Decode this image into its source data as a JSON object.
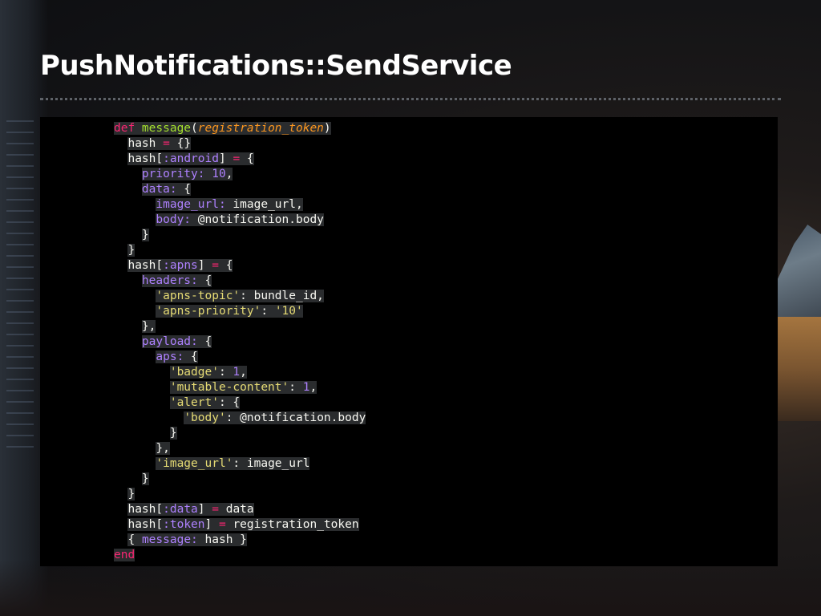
{
  "slide": {
    "title": "PushNotifications::SendService"
  },
  "code": {
    "lines": [
      [
        [
          "",
          "k",
          "def "
        ],
        [
          "",
          "f",
          "message"
        ],
        [
          "",
          "t",
          "("
        ],
        [
          "",
          "p",
          "registration_token"
        ],
        [
          "",
          "t",
          ")"
        ]
      ],
      [
        [
          "  ",
          "t",
          "hash "
        ],
        [
          "",
          "k",
          "="
        ],
        [
          "",
          "t",
          " {}"
        ]
      ],
      [
        [
          "  ",
          "t",
          "hash["
        ],
        [
          "",
          "s",
          ":android"
        ],
        [
          "",
          "t",
          "] "
        ],
        [
          "",
          "k",
          "="
        ],
        [
          "",
          "t",
          " {"
        ]
      ],
      [
        [
          "    ",
          "s",
          "priority:"
        ],
        [
          "",
          "t",
          " "
        ],
        [
          "",
          "s",
          "10"
        ],
        [
          "",
          "t",
          ","
        ]
      ],
      [
        [
          "    ",
          "s",
          "data:"
        ],
        [
          "",
          "t",
          " {"
        ]
      ],
      [
        [
          "      ",
          "s",
          "image_url:"
        ],
        [
          "",
          "t",
          " image_url,"
        ]
      ],
      [
        [
          "      ",
          "s",
          "body:"
        ],
        [
          "",
          "t",
          " @notification.body"
        ]
      ],
      [
        [
          "    ",
          "t",
          "}"
        ]
      ],
      [
        [
          "  ",
          "t",
          "}"
        ]
      ],
      [
        [
          "  ",
          "t",
          "hash["
        ],
        [
          "",
          "s",
          ":apns"
        ],
        [
          "",
          "t",
          "] "
        ],
        [
          "",
          "k",
          "="
        ],
        [
          "",
          "t",
          " {"
        ]
      ],
      [
        [
          "    ",
          "s",
          "headers:"
        ],
        [
          "",
          "t",
          " {"
        ]
      ],
      [
        [
          "      ",
          "str",
          "'apns-topic'"
        ],
        [
          "",
          "t",
          ": bundle_id,"
        ]
      ],
      [
        [
          "      ",
          "str",
          "'apns-priority'"
        ],
        [
          "",
          "t",
          ": "
        ],
        [
          "",
          "str",
          "'10'"
        ]
      ],
      [
        [
          "    ",
          "t",
          "},"
        ]
      ],
      [
        [
          "    ",
          "s",
          "payload:"
        ],
        [
          "",
          "t",
          " {"
        ]
      ],
      [
        [
          "      ",
          "s",
          "aps:"
        ],
        [
          "",
          "t",
          " {"
        ]
      ],
      [
        [
          "        ",
          "str",
          "'badge'"
        ],
        [
          "",
          "t",
          ": "
        ],
        [
          "",
          "s",
          "1"
        ],
        [
          "",
          "t",
          ","
        ]
      ],
      [
        [
          "        ",
          "str",
          "'mutable-content'"
        ],
        [
          "",
          "t",
          ": "
        ],
        [
          "",
          "s",
          "1"
        ],
        [
          "",
          "t",
          ","
        ]
      ],
      [
        [
          "        ",
          "str",
          "'alert'"
        ],
        [
          "",
          "t",
          ": {"
        ]
      ],
      [
        [
          "          ",
          "str",
          "'body'"
        ],
        [
          "",
          "t",
          ": @notification.body"
        ]
      ],
      [
        [
          "        ",
          "t",
          "}"
        ]
      ],
      [
        [
          "      ",
          "t",
          "},"
        ]
      ],
      [
        [
          "      ",
          "str",
          "'image_url'"
        ],
        [
          "",
          "t",
          ": image_url"
        ]
      ],
      [
        [
          "    ",
          "t",
          "}"
        ]
      ],
      [
        [
          "  ",
          "t",
          "}"
        ]
      ],
      [
        [
          "  ",
          "t",
          "hash["
        ],
        [
          "",
          "s",
          ":data"
        ],
        [
          "",
          "t",
          "] "
        ],
        [
          "",
          "k",
          "="
        ],
        [
          "",
          "t",
          " data"
        ]
      ],
      [
        [
          "  ",
          "t",
          "hash["
        ],
        [
          "",
          "s",
          ":token"
        ],
        [
          "",
          "t",
          "] "
        ],
        [
          "",
          "k",
          "="
        ],
        [
          "",
          "t",
          " registration_token"
        ]
      ],
      [
        [
          "  ",
          "t",
          "{ "
        ],
        [
          "",
          "s",
          "message:"
        ],
        [
          "",
          "t",
          " hash }"
        ]
      ],
      [
        [
          "",
          "k",
          "end"
        ]
      ]
    ]
  }
}
